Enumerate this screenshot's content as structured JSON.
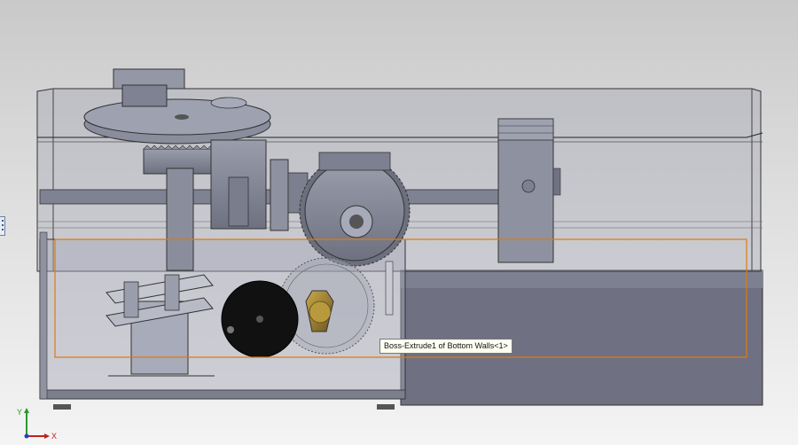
{
  "viewport": {
    "background_top": "#c9c9c9",
    "background_bottom": "#f4f4f4",
    "model_color": "#8a8d9c",
    "highlight_color": "#e07a10"
  },
  "tooltip": {
    "text": "Boss-Extrude1 of Bottom Walls<1>"
  },
  "triad": {
    "x_label": "X",
    "y_label": "Y"
  },
  "icons": {
    "side_handle": "feature-manager-toggle-icon",
    "triad": "coordinate-triad-icon"
  }
}
